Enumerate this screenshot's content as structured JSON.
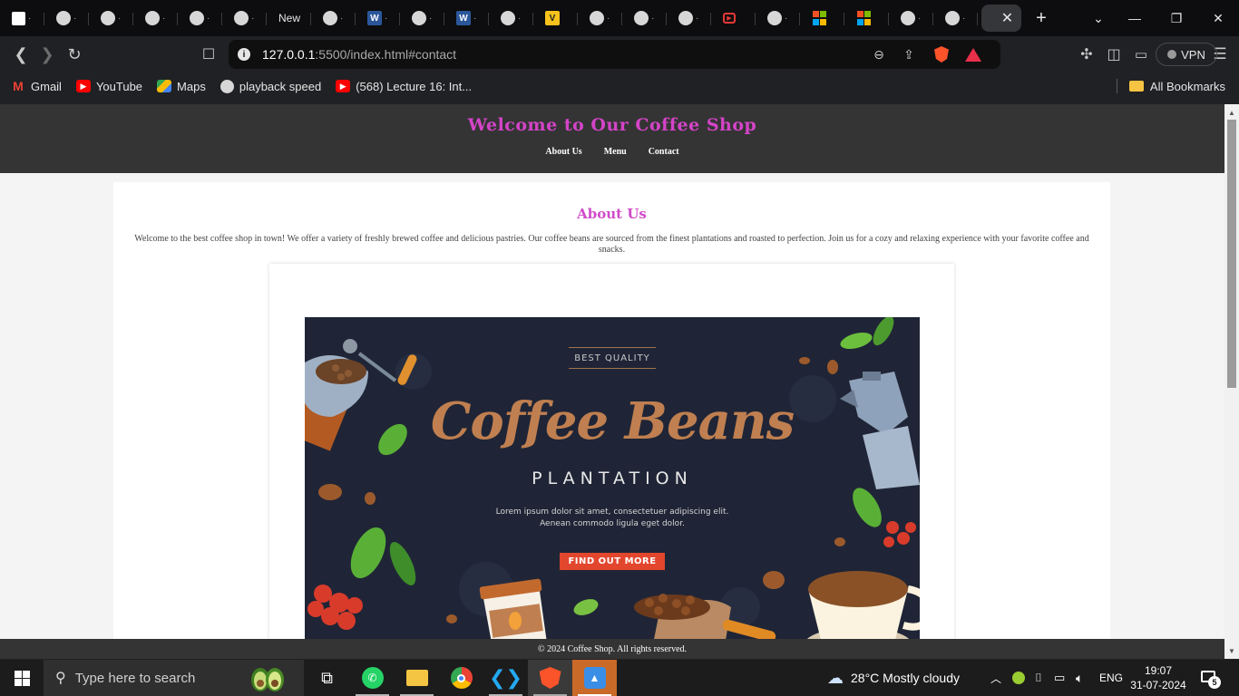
{
  "browser": {
    "tabs": [
      {
        "label": "",
        "icon": "page-icon",
        "kind": "white"
      },
      {
        "label": "",
        "icon": "globe-icon",
        "kind": "globe"
      },
      {
        "label": "",
        "icon": "globe-icon",
        "kind": "globe"
      },
      {
        "label": "",
        "icon": "globe-icon",
        "kind": "globe"
      },
      {
        "label": "",
        "icon": "globe-icon",
        "kind": "globe"
      },
      {
        "label": "",
        "icon": "globe-icon",
        "kind": "globe"
      },
      {
        "label": "New",
        "icon": "",
        "kind": "text"
      },
      {
        "label": "",
        "icon": "globe-icon",
        "kind": "globe"
      },
      {
        "label": "",
        "icon": "word-icon",
        "kind": "word"
      },
      {
        "label": "",
        "icon": "globe-icon",
        "kind": "globe"
      },
      {
        "label": "",
        "icon": "word-icon",
        "kind": "word"
      },
      {
        "label": "",
        "icon": "globe-icon",
        "kind": "globe"
      },
      {
        "label": "",
        "icon": "v-icon",
        "kind": "v"
      },
      {
        "label": "",
        "icon": "globe-icon",
        "kind": "globe"
      },
      {
        "label": "",
        "icon": "globe-icon",
        "kind": "globe"
      },
      {
        "label": "",
        "icon": "globe-icon",
        "kind": "globe"
      },
      {
        "label": "",
        "icon": "presentation-icon",
        "kind": "red"
      },
      {
        "label": "",
        "icon": "globe-icon",
        "kind": "globe"
      },
      {
        "label": "",
        "icon": "microsoft-icon",
        "kind": "ms"
      },
      {
        "label": "",
        "icon": "microsoft-icon",
        "kind": "ms"
      },
      {
        "label": "",
        "icon": "globe-icon",
        "kind": "globe"
      },
      {
        "label": "",
        "icon": "globe-icon",
        "kind": "globe"
      }
    ],
    "active_tab_close": "✕",
    "new_tab": "+",
    "url_host": "127.0.0.1",
    "url_path": ":5500/index.html#contact",
    "vpn_label": "VPN",
    "bookmarks": [
      {
        "label": "Gmail",
        "icon": "gmail-icon"
      },
      {
        "label": "YouTube",
        "icon": "youtube-icon"
      },
      {
        "label": "Maps",
        "icon": "maps-icon"
      },
      {
        "label": "playback speed",
        "icon": "globe-icon"
      },
      {
        "label": "(568) Lecture 16: Int...",
        "icon": "youtube-icon"
      }
    ],
    "all_bookmarks": "All Bookmarks"
  },
  "site": {
    "title": "Welcome to Our Coffee Shop",
    "nav": [
      "About Us",
      "Menu",
      "Contact"
    ],
    "section_title": "About Us",
    "section_text": "Welcome to the best coffee shop in town! We offer a variety of freshly brewed coffee and delicious pastries. Our coffee beans are sourced from the finest plantations and roasted to perfection. Join us for a cozy and relaxing experience with your favorite coffee and snacks.",
    "banner": {
      "badge": "BEST QUALITY",
      "title": "Coffee Beans",
      "subtitle": "PLANTATION",
      "lorem": "Lorem ipsum dolor sit amet, consectetuer adipiscing elit. Aenean commodo ligula eget dolor.",
      "button": "FIND OUT MORE"
    },
    "footer": "© 2024 Coffee Shop. All rights reserved."
  },
  "taskbar": {
    "search_placeholder": "Type here to search",
    "weather": "28°C  Mostly cloudy",
    "language": "ENG",
    "time": "19:07",
    "date": "31-07-2024",
    "notification_count": "5"
  },
  "colors": {
    "accent_magenta": "#d444c8",
    "header_bg": "#343434",
    "banner_bg": "#1f2536",
    "banner_title": "#c07f50",
    "banner_button": "#e2472e"
  }
}
